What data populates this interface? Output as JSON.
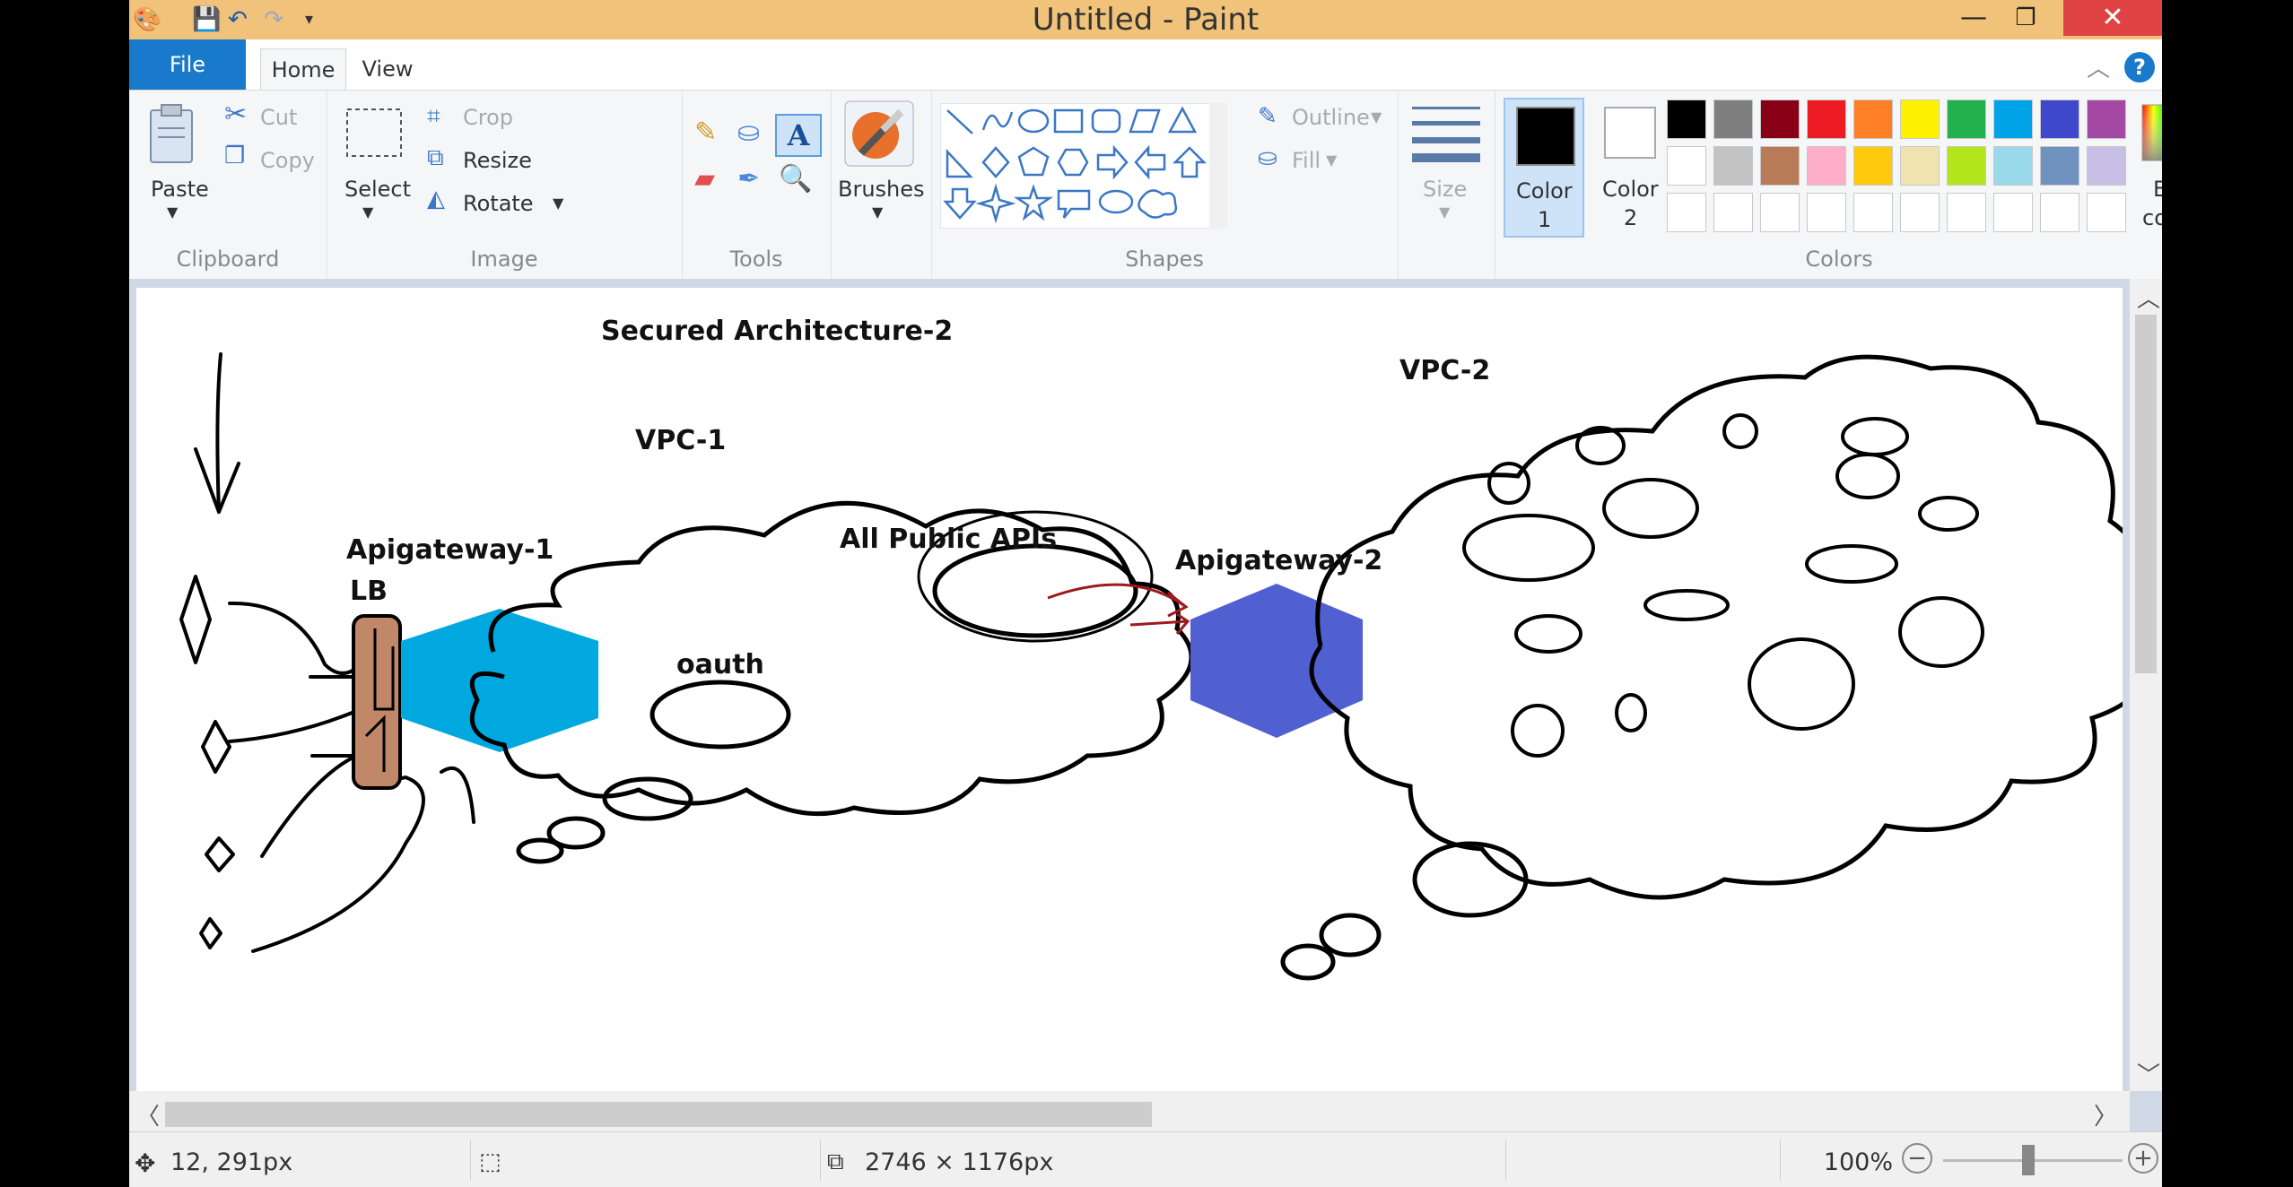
{
  "window": {
    "title": "Untitled - Paint"
  },
  "tabs": {
    "file": "File",
    "home": "Home",
    "view": "View"
  },
  "ribbon": {
    "clipboard": {
      "paste": "Paste",
      "cut": "Cut",
      "copy": "Copy",
      "label": "Clipboard"
    },
    "image": {
      "select": "Select",
      "crop": "Crop",
      "resize": "Resize",
      "rotate": "Rotate",
      "label": "Image"
    },
    "tools": {
      "label": "Tools"
    },
    "brushes": {
      "label": "Brushes"
    },
    "shapes": {
      "outline": "Outline",
      "fill": "Fill",
      "label": "Shapes"
    },
    "size": {
      "label": "Size"
    },
    "colors": {
      "color1": "Color",
      "color1_num": "1",
      "color2": "Color",
      "color2_num": "2",
      "edit_line1": "Edit",
      "edit_line2": "colors",
      "label": "Colors",
      "palette_row1": [
        "#000000",
        "#7f7f7f",
        "#880015",
        "#ed1c24",
        "#ff7f27",
        "#fff200",
        "#22b14c",
        "#00a2e8",
        "#3f48cc",
        "#a349a4"
      ],
      "palette_row2": [
        "#ffffff",
        "#c3c3c3",
        "#b97a57",
        "#ffaec9",
        "#ffc90e",
        "#efe4b0",
        "#b5e61d",
        "#99d9ea",
        "#7092be",
        "#c8bfe7"
      ]
    }
  },
  "drawing": {
    "title": "Secured Architecture-2",
    "vpc1": "VPC-1",
    "vpc2": "VPC-2",
    "apigw1": "Apigateway-1",
    "lb": "LB",
    "public_apis": "All Public APIs",
    "oauth": "oauth",
    "apigw2": "Apigateway-2",
    "colors": {
      "hex1": "#00a8e0",
      "hex2": "#5060d0",
      "lb_fill": "#c08868",
      "arrow": "#a01820"
    }
  },
  "status": {
    "cursor": "12, 291px",
    "canvas_size": "2746 × 1176px",
    "zoom": "100%"
  }
}
